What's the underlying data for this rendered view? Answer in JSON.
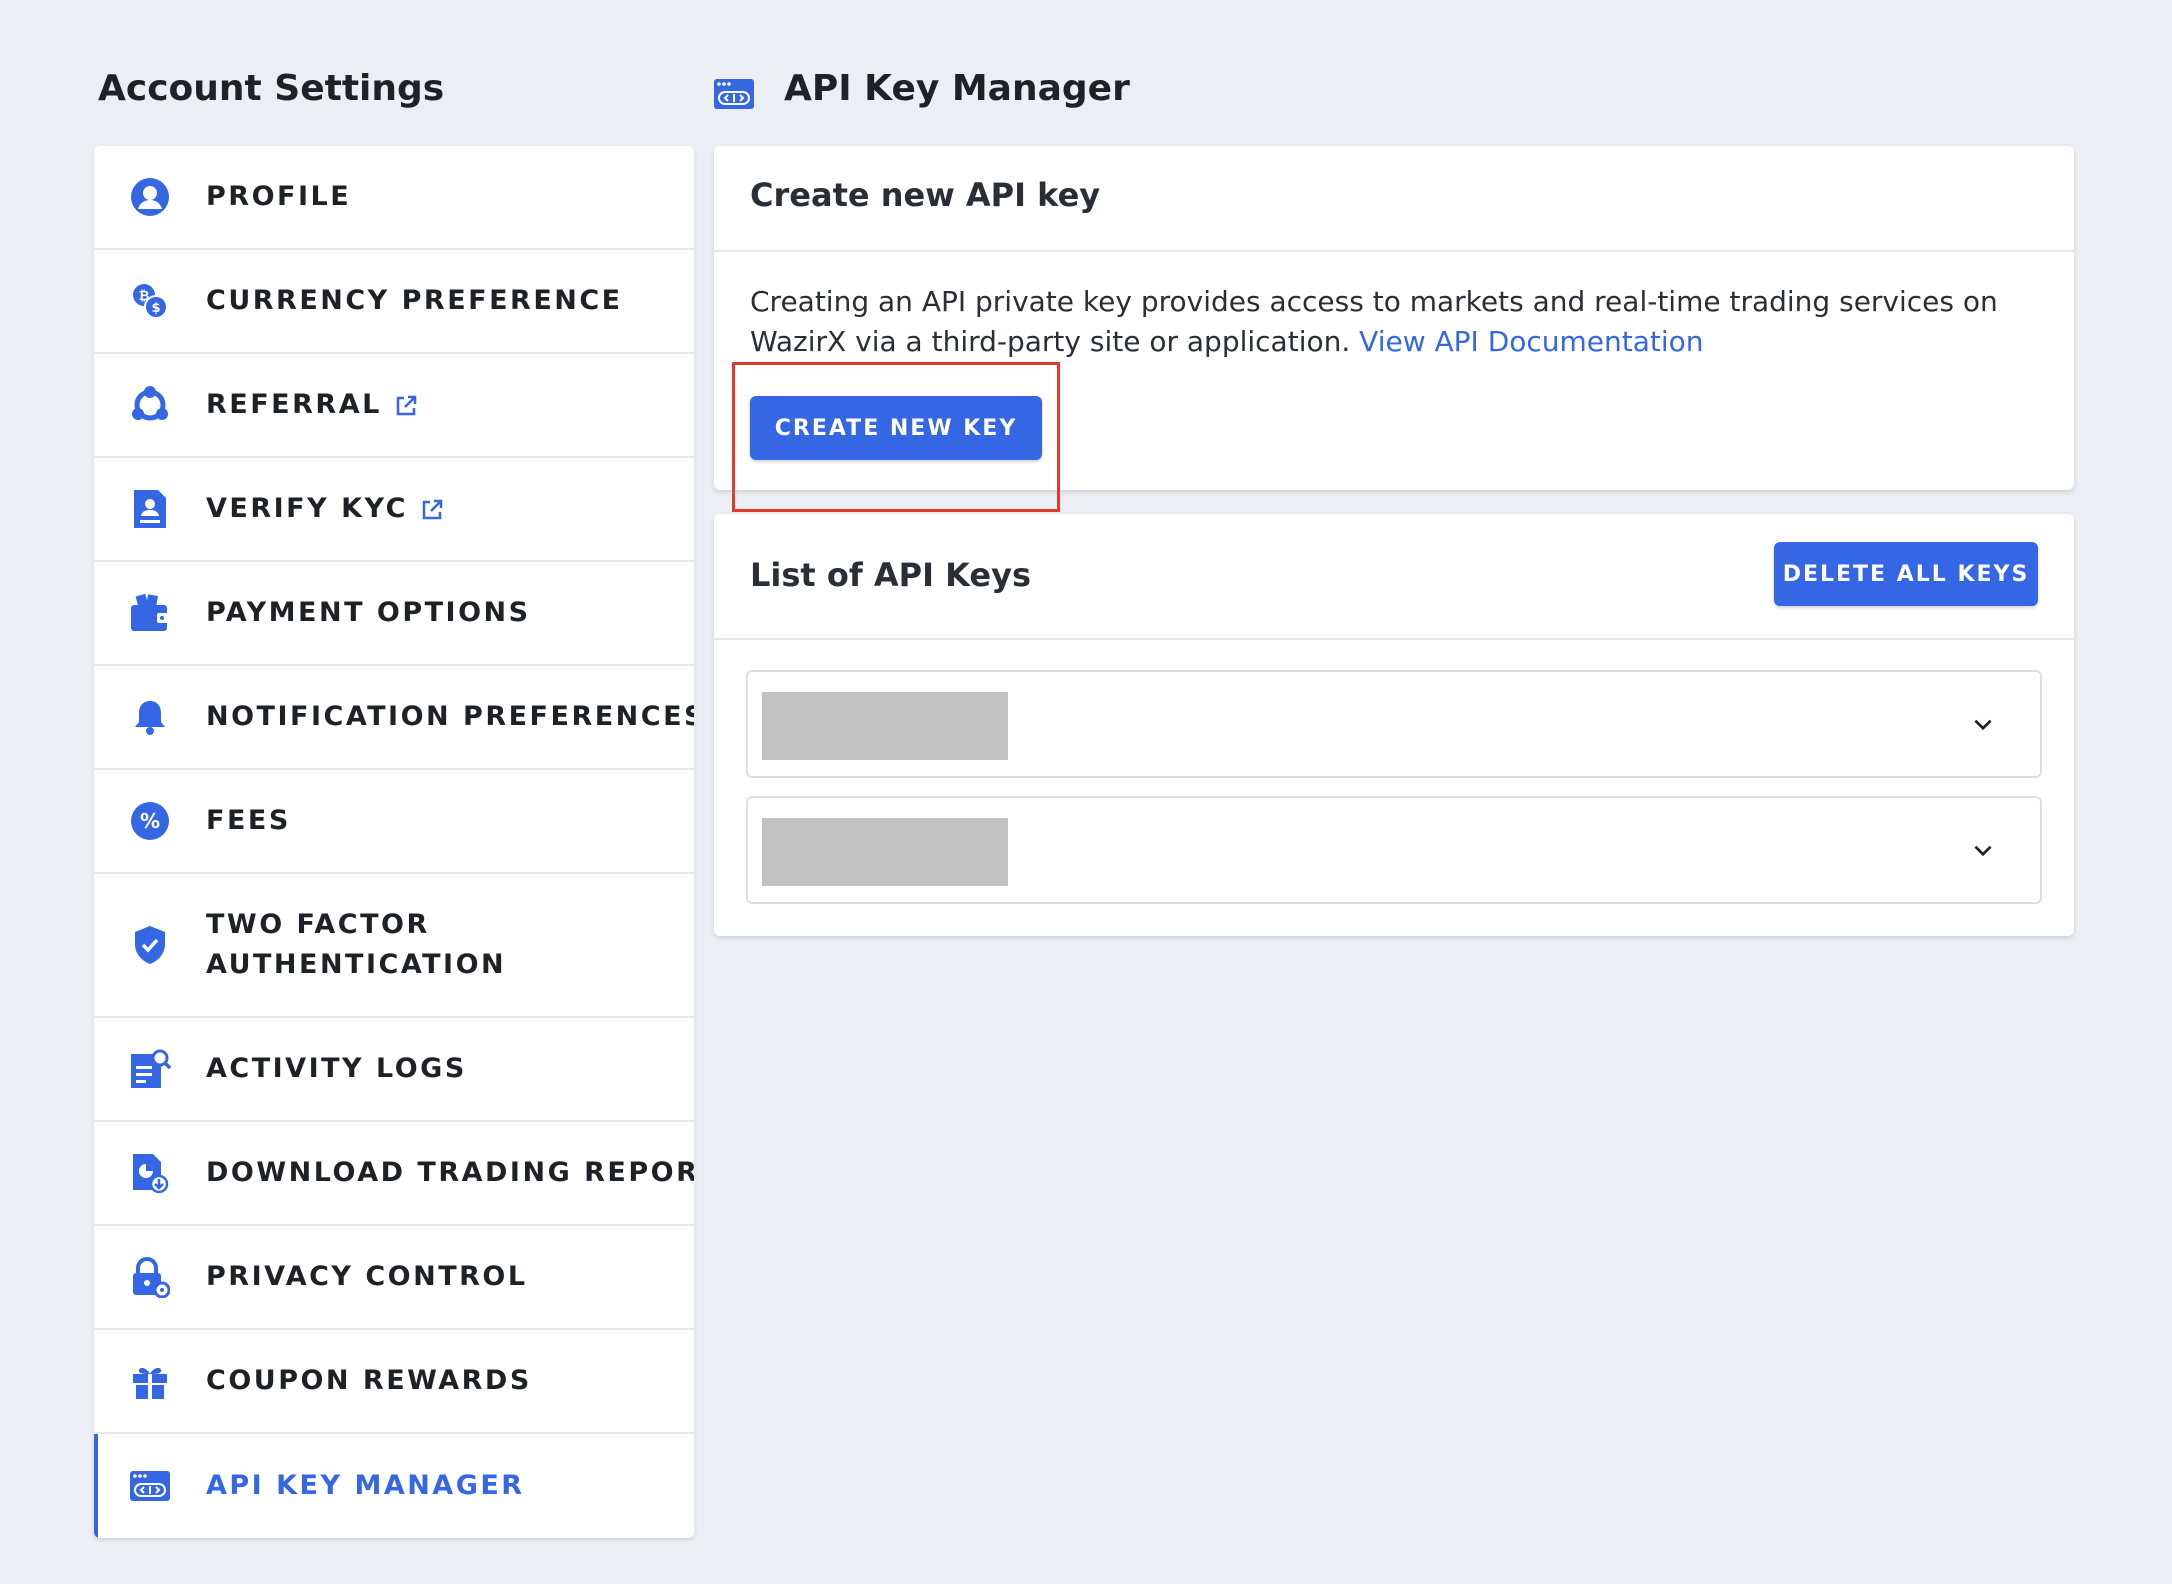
{
  "sidebar": {
    "heading": "Account Settings",
    "items": [
      {
        "label": "PROFILE",
        "icon": "profile-icon",
        "external": false
      },
      {
        "label": "CURRENCY PREFERENCE",
        "icon": "currency-icon",
        "external": false
      },
      {
        "label": "REFERRAL",
        "icon": "referral-icon",
        "external": true
      },
      {
        "label": "VERIFY KYC",
        "icon": "kyc-document-icon",
        "external": true
      },
      {
        "label": "PAYMENT OPTIONS",
        "icon": "wallet-icon",
        "external": false
      },
      {
        "label": "NOTIFICATION PREFERENCES",
        "icon": "bell-icon",
        "external": false
      },
      {
        "label": "FEES",
        "icon": "percent-icon",
        "external": false
      },
      {
        "label": "TWO FACTOR AUTHENTICATION",
        "label_line1": "TWO FACTOR",
        "label_line2": "AUTHENTICATION",
        "icon": "shield-check-icon",
        "external": false
      },
      {
        "label": "ACTIVITY LOGS",
        "icon": "activity-log-icon",
        "external": false
      },
      {
        "label": "DOWNLOAD TRADING REPORT",
        "icon": "report-download-icon",
        "external": false
      },
      {
        "label": "PRIVACY CONTROL",
        "icon": "lock-gear-icon",
        "external": false
      },
      {
        "label": "COUPON REWARDS",
        "icon": "gift-icon",
        "external": false
      },
      {
        "label": "API KEY MANAGER",
        "icon": "api-key-icon",
        "external": false,
        "active": true
      }
    ]
  },
  "main": {
    "title": "API Key Manager",
    "title_icon": "api-key-icon",
    "create_card": {
      "title": "Create new API key",
      "description": "Creating an API private key provides access to markets and real-time trading services on WazirX via a third-party site or application.",
      "doc_link": "View API Documentation",
      "button": "CREATE NEW KEY"
    },
    "list_card": {
      "title": "List of API Keys",
      "delete_button": "DELETE ALL KEYS",
      "keys_count_visible": 2
    }
  },
  "colors": {
    "accent": "#3567e4",
    "background": "#ebeef2",
    "highlight": "#e23b2b",
    "redacted": "#c2c2c2"
  }
}
